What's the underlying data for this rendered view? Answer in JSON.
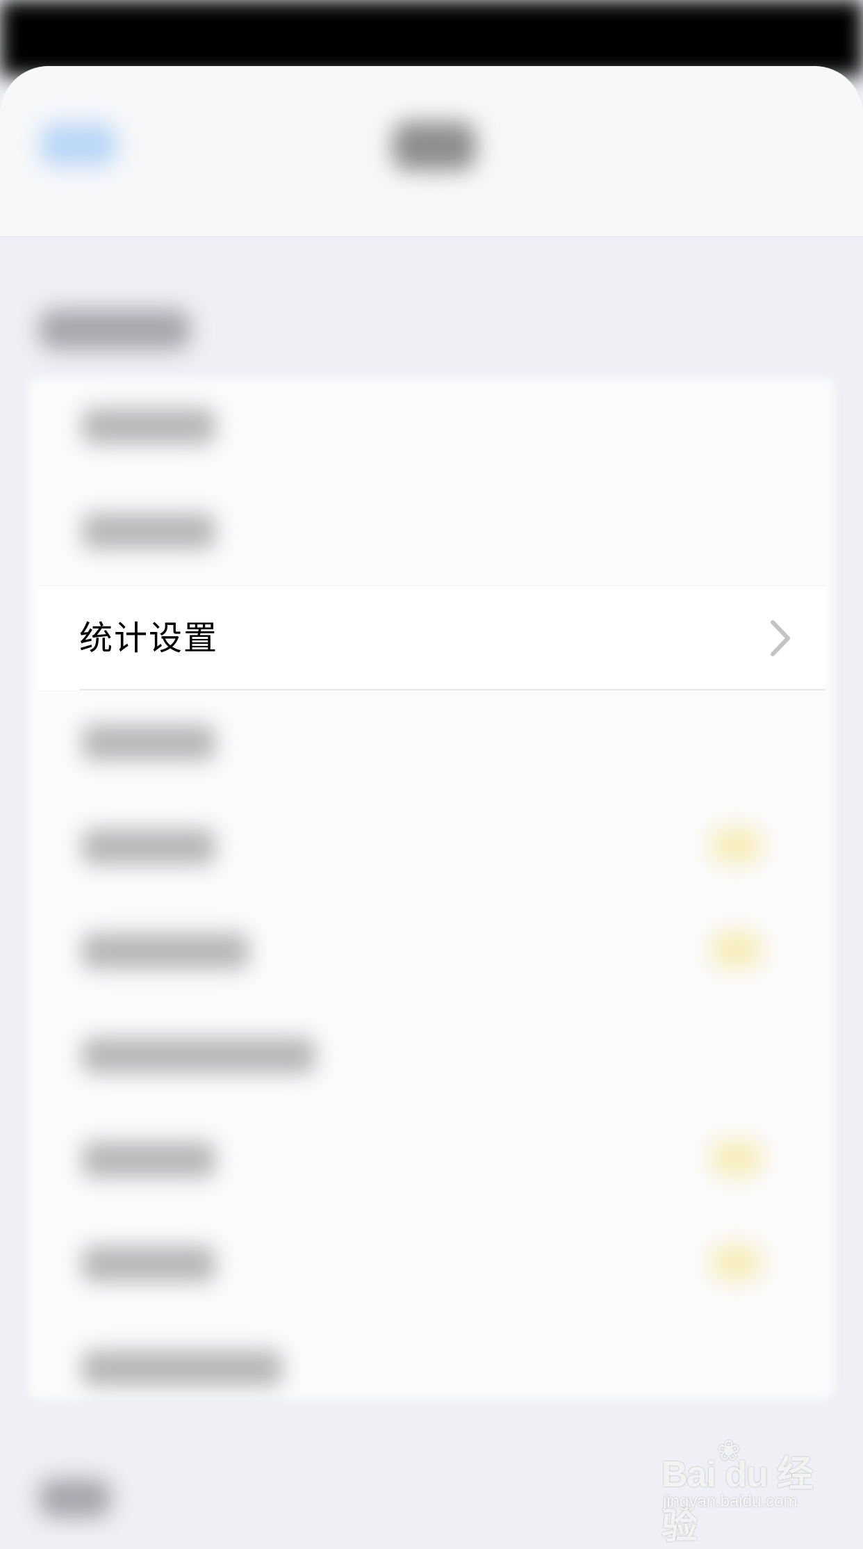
{
  "focused_row": {
    "label": "统计设置",
    "icon": "chevron-right-icon"
  },
  "watermark": {
    "logo_text": "Bai du 经验",
    "url": "jingyan.baidu.com"
  },
  "colors": {
    "background": "#eef0f5",
    "row_background": "#ffffff",
    "chevron": "#c4c4c7",
    "toggle_blur": "#f6ecb7"
  }
}
